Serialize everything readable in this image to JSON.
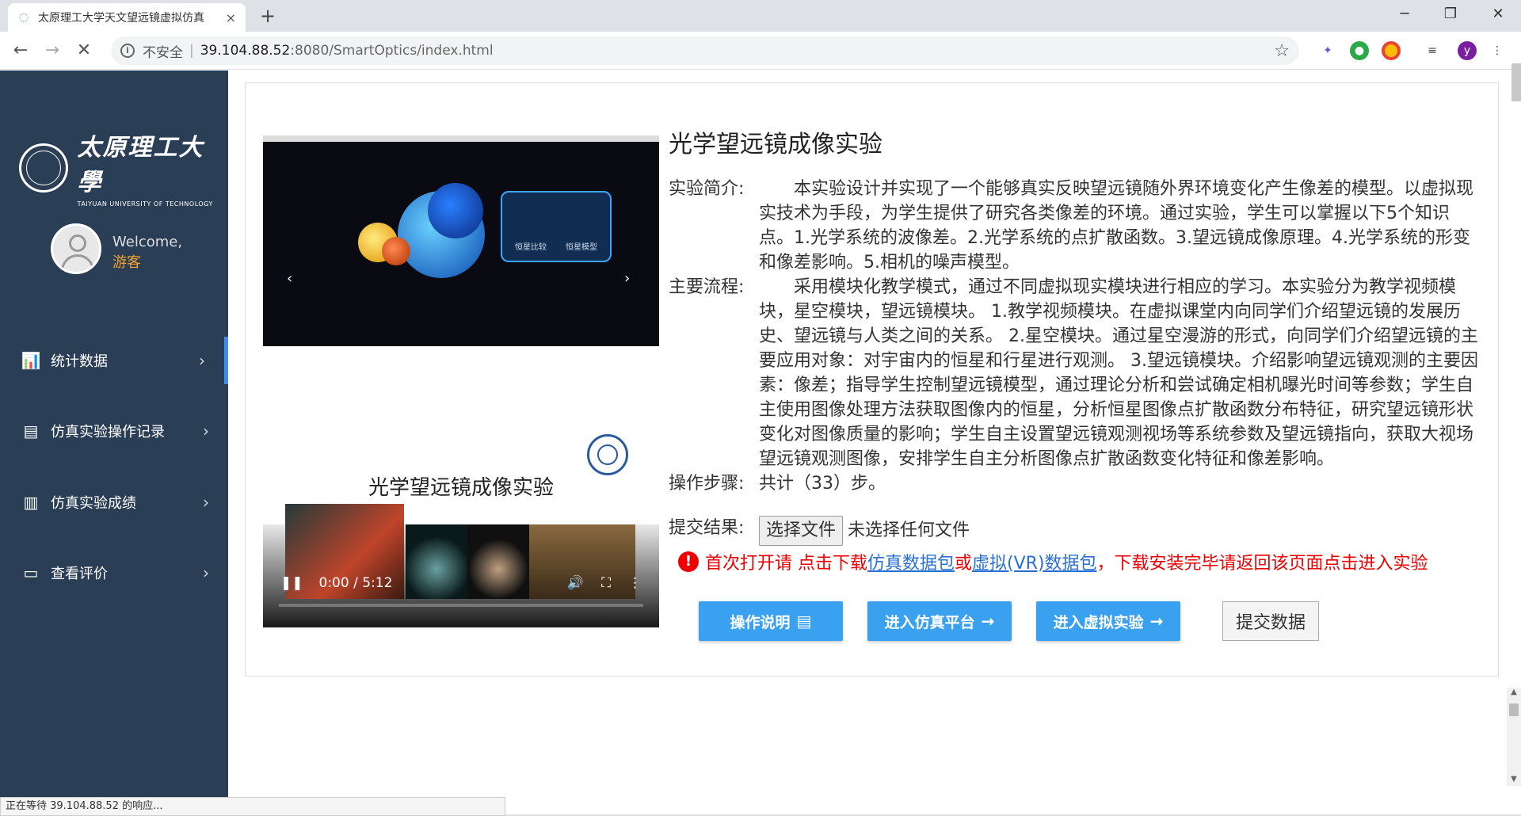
{
  "browser": {
    "tab_title": "太原理工大学天文望远镜虚拟仿真",
    "close_tab": "×",
    "new_tab": "+",
    "insecure_label": "不安全",
    "url_host": "39.104.88.52",
    "url_path": ":8080/SmartOptics/index.html",
    "profile_initial": "y",
    "status_text": "正在等待 39.104.88.52 的响应..."
  },
  "sidebar": {
    "logo_cn": "太原理工大學",
    "logo_en": "TAIYUAN UNIVERSITY OF TECHNOLOGY",
    "welcome": "Welcome,",
    "guest": "游客",
    "items": [
      {
        "label": "统计数据",
        "icon": "bar-chart-icon"
      },
      {
        "label": "仿真实验操作记录",
        "icon": "clipboard-icon"
      },
      {
        "label": "仿真实验成绩",
        "icon": "column-chart-icon"
      },
      {
        "label": "查看评价",
        "icon": "comment-icon"
      }
    ]
  },
  "main": {
    "title": "光学望远镜成像实验",
    "intro_key": "实验简介:",
    "intro_text": "本实验设计并实现了一个能够真实反映望远镜随外界环境变化产生像差的模型。以虚拟现实技术为手段，为学生提供了研究各类像差的环境。通过实验，学生可以掌握以下5个知识点。1.光学系统的波像差。2.光学系统的点扩散函数。3.望远镜成像原理。4.光学系统的形变和像差影响。5.相机的噪声模型。",
    "flow_key": "主要流程:",
    "flow_text": "采用模块化教学模式，通过不同虚拟现实模块进行相应的学习。本实验分为教学视频模块，星空模块，望远镜模块。 1.教学视频模块。在虚拟课堂内向同学们介绍望远镜的发展历史、望远镜与人类之间的关系。 2.星空模块。通过星空漫游的形式，向同学们介绍望远镜的主要应用对象：对宇宙内的恒星和行星进行观测。 3.望远镜模块。介绍影响望远镜观测的主要因素：像差；指导学生控制望远镜模型，通过理论分析和尝试确定相机曝光时间等参数；学生自主使用图像处理方法获取图像内的恒星，分析恒星图像点扩散函数分布特征，研究望远镜形状变化对图像质量的影响；学生自主设置望远镜观测视场等系统参数及望远镜指向，获取大视场望远镜观测图像，安排学生自主分析图像点扩散函数变化特征和像差影响。",
    "steps_key": "操作步骤:",
    "steps_text": "共计（33）步。",
    "submit_key": "提交结果:",
    "choose_file": "选择文件",
    "no_file": "未选择任何文件",
    "warn_a": "首次打开请 点击下载",
    "warn_link1": "仿真数据包",
    "warn_or": "或",
    "warn_link2": "虚拟(VR)数据包",
    "warn_b": "，下载安装完毕请返回该页面点击进入实验",
    "btn_manual": "操作说明",
    "btn_sim": "进入仿真平台",
    "btn_vr": "进入虚拟实验",
    "btn_submit": "提交数据",
    "screenshot_labels": [
      "恒星比较",
      "恒星模型"
    ],
    "video_title": "光学望远镜成像实验",
    "video_time": "0:00 / 5:12",
    "video_progress": 0
  }
}
